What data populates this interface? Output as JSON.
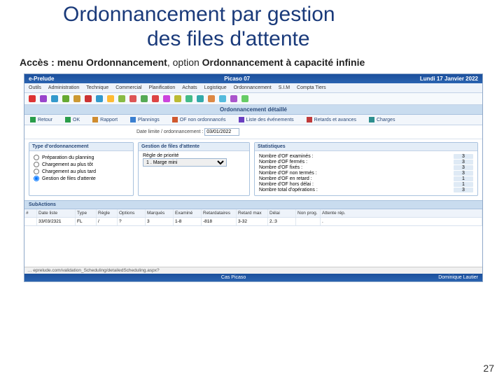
{
  "slide": {
    "title_l1": "Ordonnancement par gestion",
    "title_l2": "des files d'attente",
    "access_prefix": "Accès : menu ",
    "access_menu": "Ordonnancement",
    "access_mid": ", option ",
    "access_option": "Ordonnancement à capacité infinie",
    "page_number": "27"
  },
  "app": {
    "name": "e-Prelude",
    "center": "Picaso 07",
    "date": "Lundi 17 Janvier 2022",
    "menus": [
      "Outils",
      "Administration",
      "Technique",
      "Commercial",
      "Planification",
      "Achats",
      "Logistique",
      "Ordonnancement",
      "S.I.M",
      "Compta Tiers"
    ],
    "icon_colors": [
      "#d33",
      "#94c",
      "#39c",
      "#6a3",
      "#c93",
      "#c33",
      "#39c",
      "#fb3",
      "#8b4",
      "#d55",
      "#5a5",
      "#d44",
      "#c4d",
      "#bb3",
      "#4b8",
      "#3aa",
      "#d84",
      "#5bd",
      "#a5c",
      "#6c6"
    ],
    "subheader": "Ordonnancement détaillé",
    "actions": [
      {
        "label": "Retour",
        "color": "#2a9d4a"
      },
      {
        "label": "OK",
        "color": "#2a9d4a"
      },
      {
        "label": "Rapport",
        "color": "#d08c2e"
      },
      {
        "label": "Plannings",
        "color": "#3a7fd0"
      },
      {
        "label": "OF non ordonnancés",
        "color": "#d0582e"
      },
      {
        "label": "Liste des événements",
        "color": "#6a3fc0"
      },
      {
        "label": "Retards et avances",
        "color": "#c03a3a"
      },
      {
        "label": "Charges",
        "color": "#2e8f8f"
      }
    ],
    "date_label": "Date limite / ordonnancement :",
    "date_value": "03/01/2022"
  },
  "panel1": {
    "title": "Type d'ordonnancement",
    "options": [
      "Préparation du planning",
      "Chargement au plus tôt",
      "Chargement au plus tard",
      "Gestion de files d'attente"
    ],
    "selected": 3
  },
  "panel2": {
    "title": "Gestion de files d'attente",
    "rule_label": "Règle de priorité",
    "rule_value": "1 . Marge mini"
  },
  "panel3": {
    "title": "Statistiques",
    "rows": [
      {
        "label": "Nombre d'OF examinés :",
        "val": "3"
      },
      {
        "label": "Nombre d'OF fermés :",
        "val": "3"
      },
      {
        "label": "Nombre d'OF fixés :",
        "val": "3"
      },
      {
        "label": "Nombre d'OF non termés :",
        "val": "3"
      },
      {
        "label": "Nombre d'OF en retard :",
        "val": "1"
      },
      {
        "label": "Nombre d'OF hors délai :",
        "val": "1"
      },
      {
        "label": "Nombre total d'opérations :",
        "val": "3"
      }
    ]
  },
  "grid": {
    "title": "SubActions",
    "headers": [
      "#",
      "Date liste",
      "Type",
      "Règle",
      "Options",
      "Marqués",
      "Examiné",
      "Retardataires",
      "Retard max",
      "Délai",
      "Non prog.",
      "Attente rép."
    ],
    "row": [
      " ",
      "33/03/2321",
      "FL",
      "/",
      "?",
      "3",
      "1-8",
      "-818",
      "3-32",
      "2.:3",
      "",
      "."
    ]
  },
  "footer": {
    "left": "",
    "center": "Cas Picaso",
    "right": "Dominique Lautier",
    "status": "… eprelude.com/validation_Scheduling/detailedScheduling.aspx?"
  }
}
